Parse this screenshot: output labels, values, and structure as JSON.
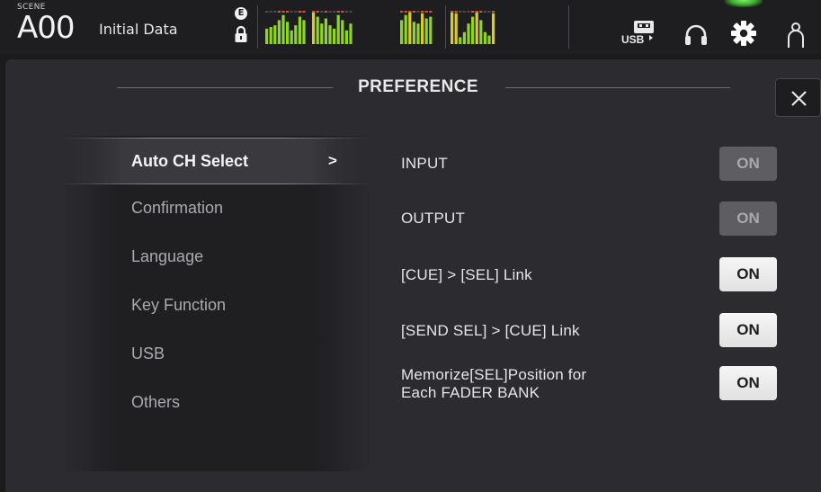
{
  "header": {
    "scene_label": "SCENE",
    "scene_number": "A00",
    "scene_name": "Initial Data",
    "status_icons": [
      "e-icon",
      "lock-icon"
    ],
    "icons": [
      "usb-icon",
      "headphones-icon",
      "gear-icon",
      "user-icon"
    ],
    "meter_levels": [
      [
        0.45,
        0.5,
        0.55,
        0.7,
        0.85,
        0.65,
        0.4,
        0.55,
        0.8,
        0.7
      ],
      [
        0.95,
        0.8,
        0.6,
        0.75,
        0.55,
        0.45,
        0.85,
        0.7,
        0.4,
        0.6
      ],
      [
        0.7,
        0.85,
        0.95,
        0.65,
        0.6,
        0.9,
        0.75,
        0.8
      ],
      [
        0.95,
        0.9,
        0.2,
        0.35,
        0.6,
        0.8,
        0.95,
        0.7,
        0.35,
        0.25,
        0.9
      ]
    ],
    "colors": {
      "meter_green": "#8ed42a",
      "meter_yellow": "#d8c83a",
      "meter_peak": "#e05020",
      "gear_active": "#6fe35e"
    }
  },
  "dialog": {
    "title": "PREFERENCE",
    "close_icon": "close-icon"
  },
  "menu": {
    "items": [
      {
        "label": "Auto CH Select",
        "active": true
      },
      {
        "label": "Confirmation",
        "active": false
      },
      {
        "label": "Language",
        "active": false
      },
      {
        "label": "Key Function",
        "active": false
      },
      {
        "label": "USB",
        "active": false
      },
      {
        "label": "Others",
        "active": false
      }
    ],
    "chevron": ">"
  },
  "settings": [
    {
      "label": "INPUT",
      "value": "ON",
      "state": "dim"
    },
    {
      "label": "OUTPUT",
      "value": "ON",
      "state": "dim"
    },
    {
      "label": "[CUE] > [SEL] Link",
      "value": "ON",
      "state": "lit"
    },
    {
      "label": "[SEND SEL] > [CUE] Link",
      "value": "ON",
      "state": "lit"
    },
    {
      "label_line1": "Memorize[SEL]Position for",
      "label_line2": "Each FADER BANK",
      "value": "ON",
      "state": "lit"
    }
  ]
}
